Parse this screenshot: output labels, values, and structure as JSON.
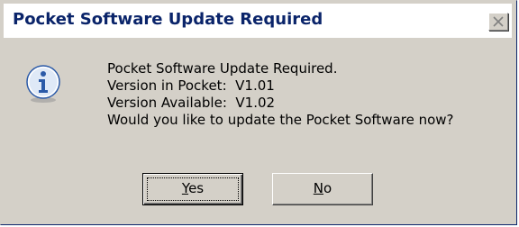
{
  "dialog": {
    "title": "Pocket Software Update Required",
    "icon": "info-icon",
    "message_lines": [
      "Pocket Software Update Required.",
      "Version in Pocket:  V1.01",
      "Version Available:  V1.02",
      "Would you like to update the Pocket Software now?"
    ],
    "buttons": {
      "yes": {
        "accel": "Y",
        "rest": "es"
      },
      "no": {
        "accel": "N",
        "rest": "o"
      }
    }
  },
  "colors": {
    "title_text": "#0a246a",
    "face": "#d4d0c8",
    "icon_blue": "#3b6fc4"
  }
}
